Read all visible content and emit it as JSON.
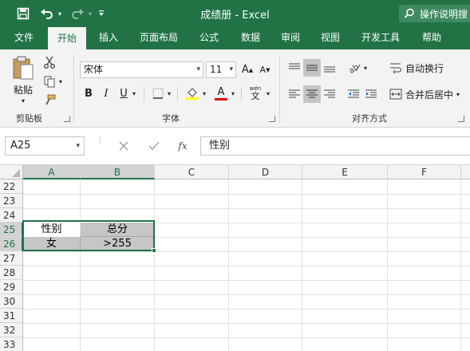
{
  "app": {
    "title": "成绩册  -  Excel",
    "tell_me": "操作说明搜"
  },
  "tabs": [
    "文件",
    "开始",
    "插入",
    "页面布局",
    "公式",
    "数据",
    "审阅",
    "视图",
    "开发工具",
    "帮助"
  ],
  "active_tab": "开始",
  "ribbon": {
    "clipboard": {
      "paste_label": "粘贴",
      "group_label": "剪贴板"
    },
    "font": {
      "font_name": "宋体",
      "font_size": "11",
      "bold": "B",
      "italic": "I",
      "underline": "U",
      "font_color_glyph": "A",
      "phonetic_glyph": "wén",
      "phonetic_glyph2": "文",
      "grow_glyph": "A",
      "shrink_glyph": "A",
      "group_label": "字体"
    },
    "alignment": {
      "wrap_text": "自动换行",
      "merge_center": "合并后居中",
      "group_label": "对齐方式"
    }
  },
  "formula_bar": {
    "name_box": "A25",
    "fx": "fx",
    "value": "性别"
  },
  "columns": [
    "A",
    "B",
    "C",
    "D",
    "E",
    "F"
  ],
  "rows": [
    "22",
    "23",
    "24",
    "25",
    "26",
    "27",
    "28",
    "29",
    "30",
    "31",
    "32",
    "33"
  ],
  "cells": {
    "A25": "性别",
    "B25": "总分",
    "A26": "女",
    "B26": ">255"
  },
  "colors": {
    "accent": "#217346",
    "selection_fill": "#c6c6c6"
  }
}
